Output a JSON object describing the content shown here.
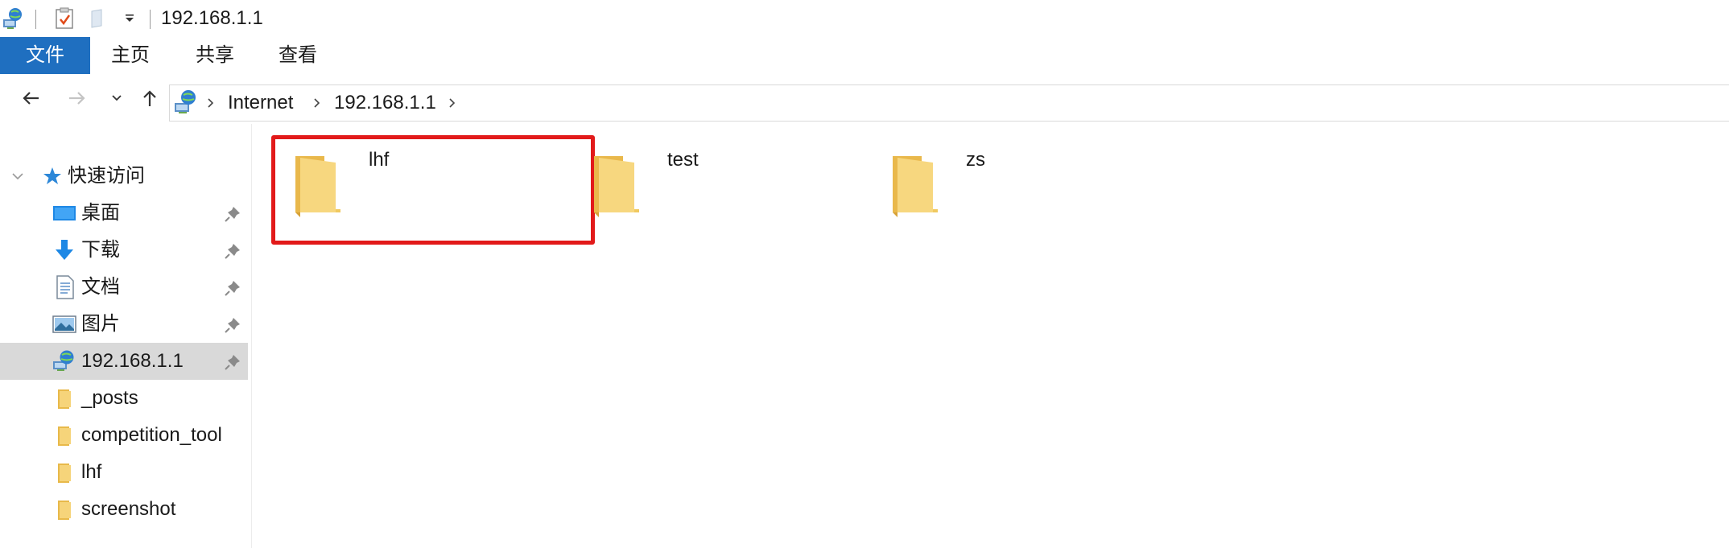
{
  "window": {
    "title": "192.168.1.1"
  },
  "ribbon": {
    "tabs": [
      "文件",
      "主页",
      "共享",
      "查看"
    ]
  },
  "address": {
    "crumbs": [
      "Internet",
      "192.168.1.1"
    ]
  },
  "sidebar": {
    "quick_access": "快速访问",
    "items": [
      {
        "label": "桌面",
        "icon": "desktop-icon",
        "pinned": true
      },
      {
        "label": "下载",
        "icon": "download-icon",
        "pinned": true
      },
      {
        "label": "文档",
        "icon": "documents-icon",
        "pinned": true
      },
      {
        "label": "图片",
        "icon": "pictures-icon",
        "pinned": true
      },
      {
        "label": "192.168.1.1",
        "icon": "network-location-icon",
        "pinned": true,
        "selected": true
      },
      {
        "label": "_posts",
        "icon": "folder-icon",
        "pinned": false
      },
      {
        "label": "competition_tool",
        "icon": "folder-icon",
        "pinned": false
      },
      {
        "label": "lhf",
        "icon": "folder-icon",
        "pinned": false
      },
      {
        "label": "screenshot",
        "icon": "folder-icon",
        "pinned": false
      }
    ]
  },
  "content": {
    "folders": [
      {
        "name": "lhf",
        "highlighted": true
      },
      {
        "name": "test",
        "highlighted": false
      },
      {
        "name": "zs",
        "highlighted": false
      }
    ]
  },
  "colors": {
    "file_tab": "#1f6fc0",
    "selection": "#d9d9d9",
    "highlight_box": "#e21a1a",
    "folder": "#f6d47a"
  }
}
